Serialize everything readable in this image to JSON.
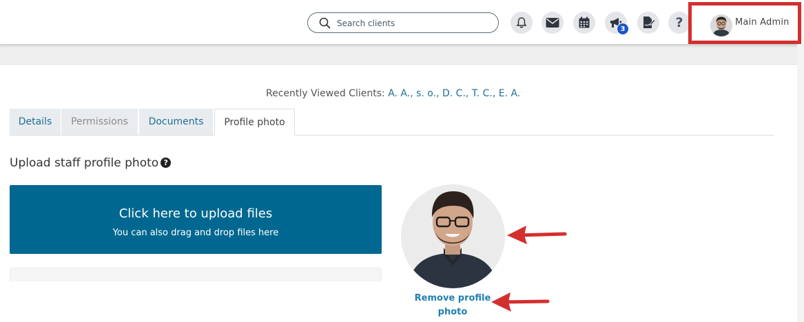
{
  "header": {
    "search": {
      "placeholder": "Search clients"
    },
    "icons": [
      "bell-icon",
      "mail-icon",
      "calendar-icon",
      "megaphone-icon",
      "signature-icon",
      "help-icon"
    ],
    "notification_badge": "3",
    "help_glyph": "?",
    "user": {
      "name": "Main Admin"
    }
  },
  "recent": {
    "label": "Recently Viewed Clients:",
    "clients": [
      "A. A.,",
      "s. o.,",
      "D. C.,",
      "T. C.,",
      "E. A."
    ]
  },
  "tabs": [
    {
      "label": "Details",
      "state": "inactive"
    },
    {
      "label": "Permissions",
      "state": "disabled"
    },
    {
      "label": "Documents",
      "state": "inactive"
    },
    {
      "label": "Profile photo",
      "state": "active"
    }
  ],
  "main": {
    "section_title": "Upload staff profile photo",
    "help_glyph": "?",
    "upload": {
      "title": "Click here to upload files",
      "subtitle": "You can also drag and drop files here"
    },
    "remove_link": {
      "line1": "Remove profile",
      "line2": "photo"
    }
  },
  "colors": {
    "upload_bg": "#006890",
    "link": "#1f6f93",
    "highlight_border": "#d32f2f",
    "badge": "#1a56c8",
    "arrow": "#d32f2f"
  }
}
